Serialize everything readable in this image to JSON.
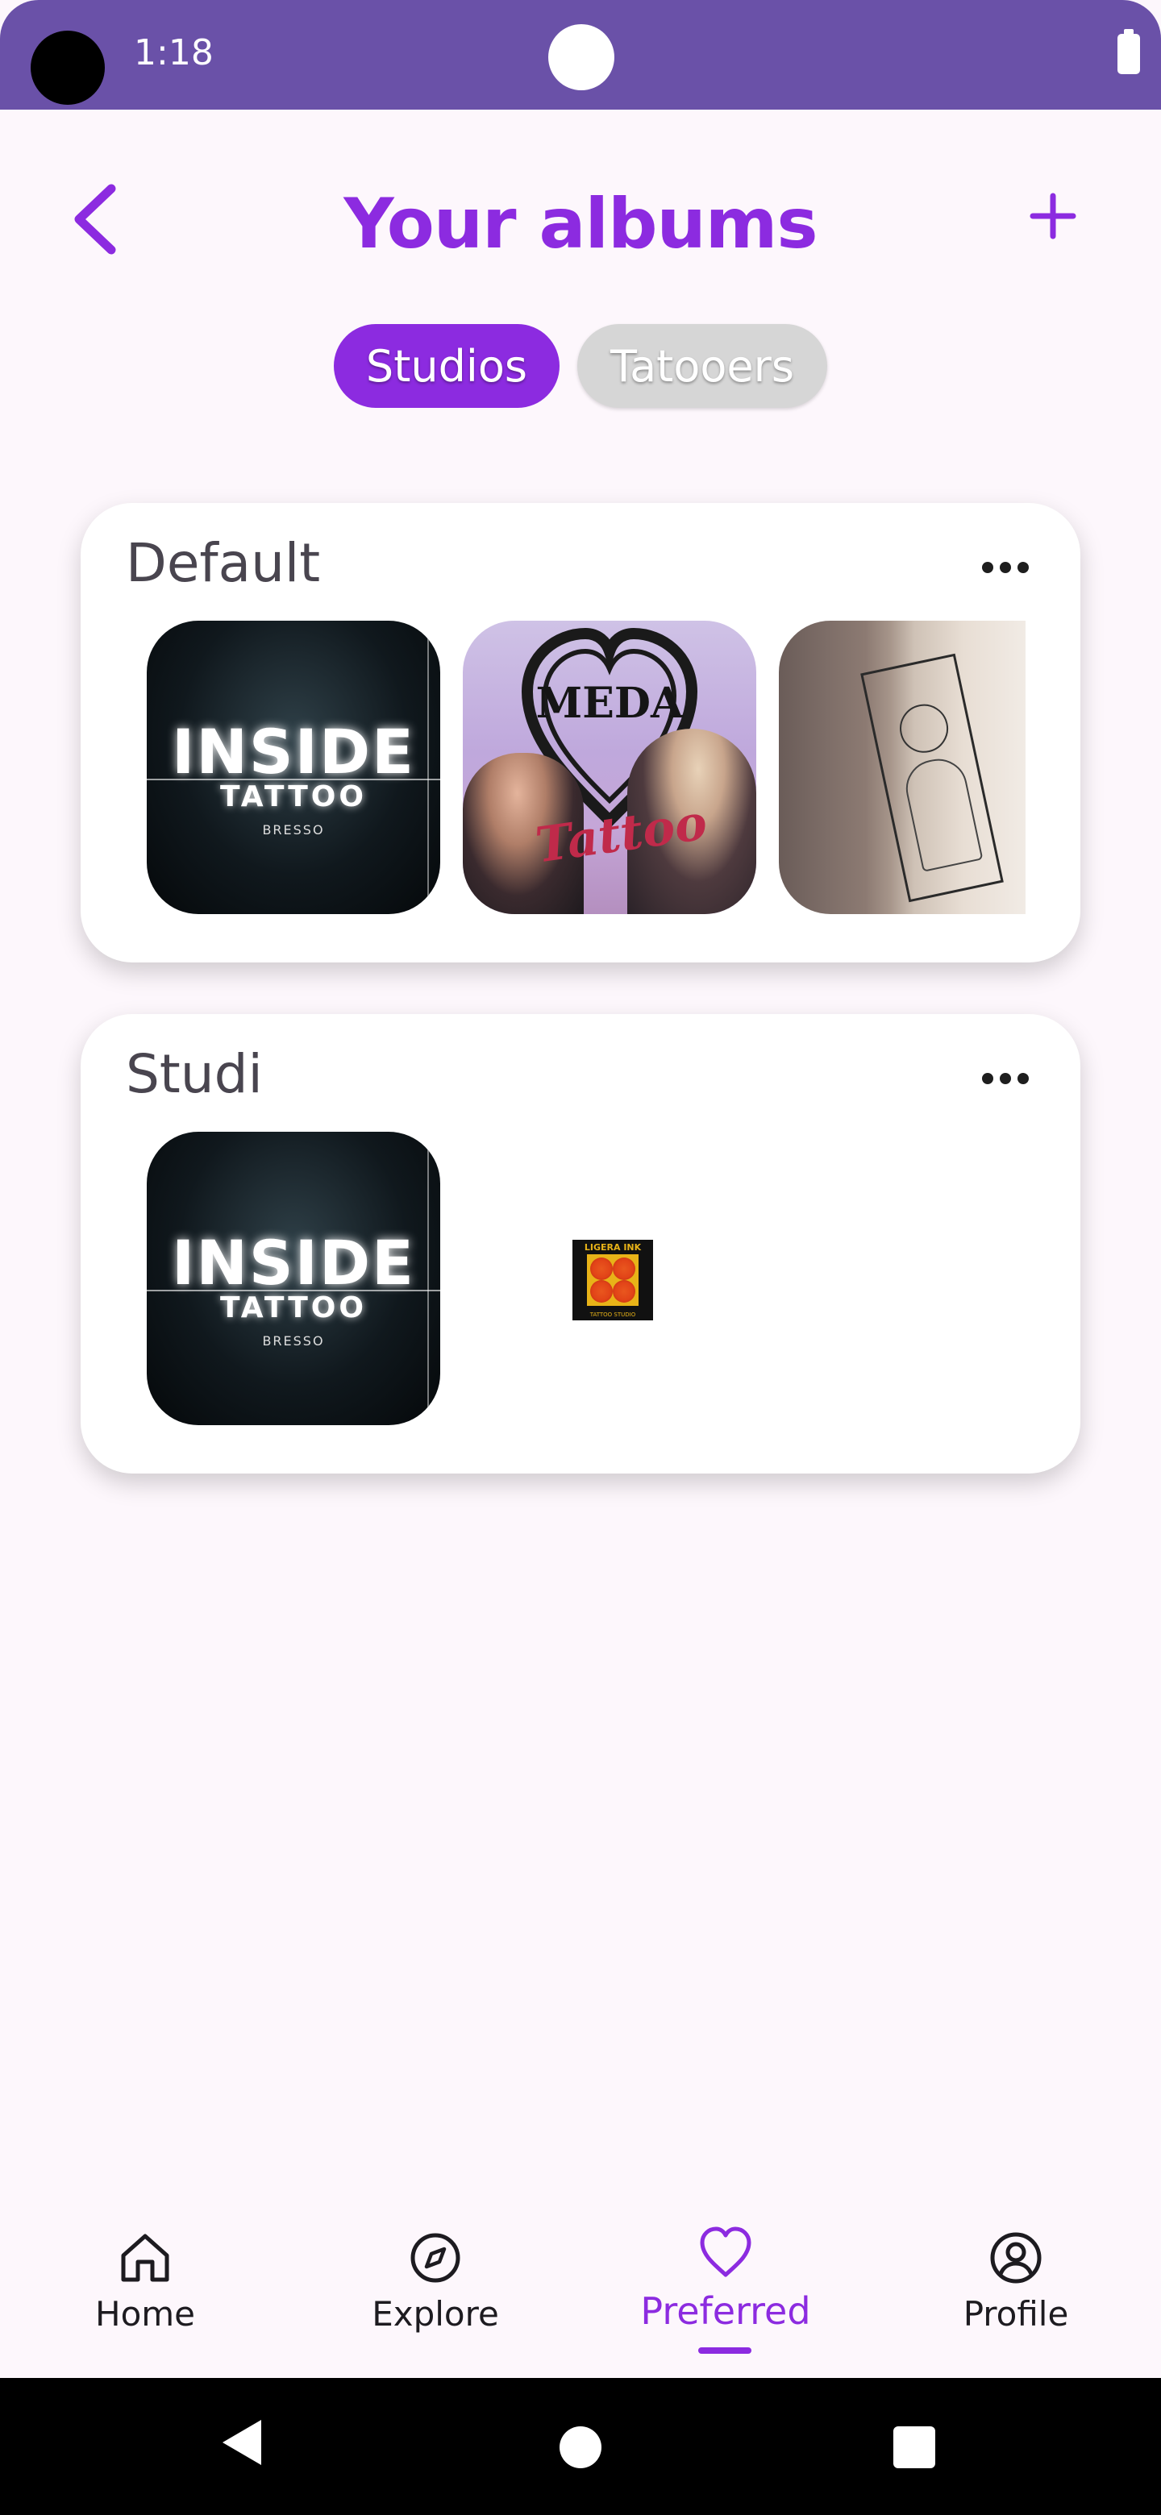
{
  "status_bar": {
    "time": "1:18"
  },
  "header": {
    "title": "Your albums",
    "back_icon": "chevron-left-icon",
    "add_icon": "plus-icon"
  },
  "tabs": [
    {
      "label": "Studios",
      "active": true
    },
    {
      "label": "Tatooers",
      "active": false
    }
  ],
  "albums": [
    {
      "name": "Default",
      "items": [
        {
          "image": "inside-tattoo-logo",
          "logo_text": "INSIDE",
          "logo_sub": "TATTOO",
          "logo_small": "BRESSO"
        },
        {
          "image": "medusa-tattoo-photo",
          "overlay_text": "Tattoo"
        },
        {
          "image": "arm-tattoo-photo"
        }
      ]
    },
    {
      "name": "Studi",
      "items": [
        {
          "image": "inside-tattoo-logo",
          "logo_text": "INSIDE",
          "logo_sub": "TATTOO",
          "logo_small": "BRESSO"
        },
        {
          "image": "ligera-ink-logo",
          "logo_text": "LIGERA INK",
          "logo_sub": "TATTOO STUDIO"
        }
      ]
    }
  ],
  "bottom_nav": {
    "items": [
      {
        "label": "Home",
        "icon": "home-icon",
        "active": false
      },
      {
        "label": "Explore",
        "icon": "compass-icon",
        "active": false
      },
      {
        "label": "Preferred",
        "icon": "heart-icon",
        "active": true
      },
      {
        "label": "Profile",
        "icon": "user-circle-icon",
        "active": false
      }
    ]
  },
  "colors": {
    "accent": "#8C2BE0",
    "status_bar": "#6A51A8",
    "background": "#FDF7FC",
    "inactive_tab": "#D6D6D6"
  }
}
